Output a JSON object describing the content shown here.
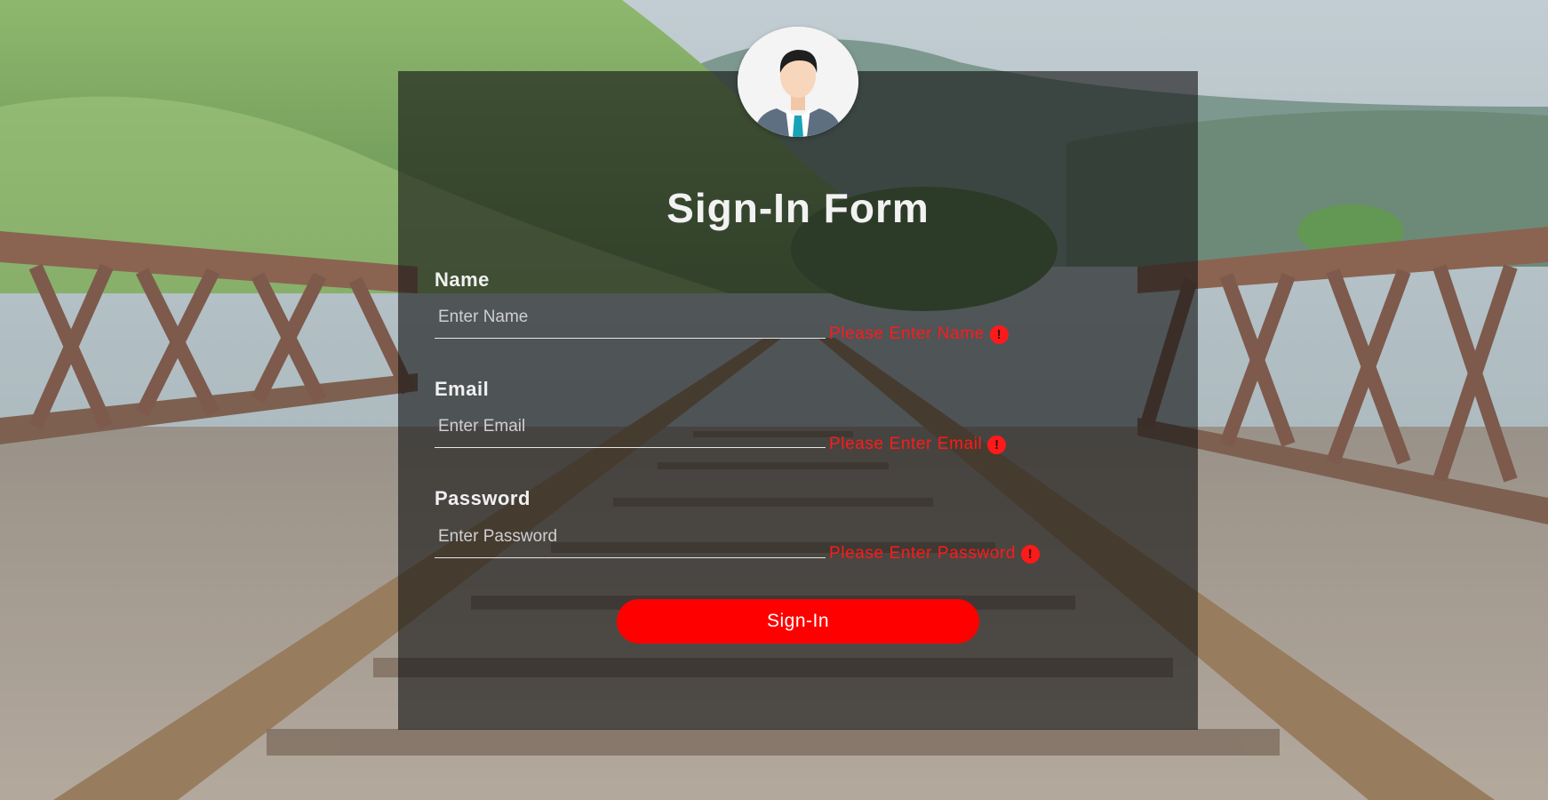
{
  "form": {
    "title": "Sign-In Form",
    "fields": [
      {
        "label": "Name",
        "placeholder": "Enter Name",
        "value": "",
        "error": "Please Enter Name"
      },
      {
        "label": "Email",
        "placeholder": "Enter Email",
        "value": "",
        "error": "Please Enter Email"
      },
      {
        "label": "Password",
        "placeholder": "Enter Password",
        "value": "",
        "error": "Please Enter Password"
      }
    ],
    "error_icon": "!",
    "submit_label": "Sign-In"
  },
  "avatar": {
    "icon": "user-avatar-icon"
  },
  "colors": {
    "accent": "#ff0000",
    "error": "#ff1a1a",
    "card_overlay": "rgba(20,20,20,0.62)",
    "text": "#f2f2f2"
  }
}
